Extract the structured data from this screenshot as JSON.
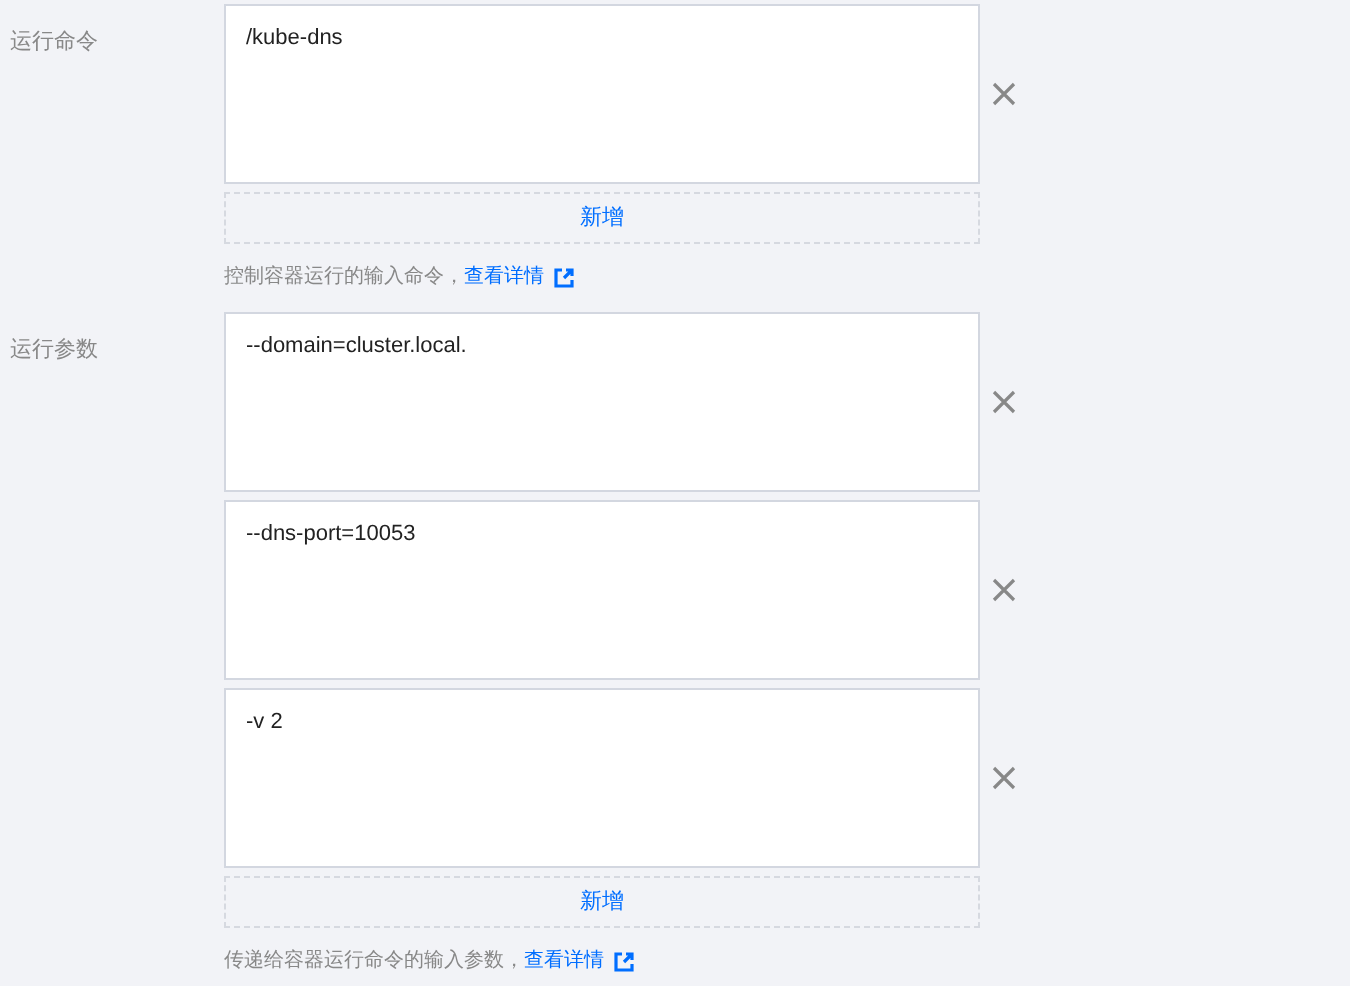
{
  "sections": [
    {
      "label": "运行命令",
      "values": [
        "/kube-dns"
      ],
      "add_button": "新增",
      "help": "控制容器运行的输入命令，",
      "help_link": "查看详情"
    },
    {
      "label": "运行参数",
      "values": [
        "--domain=cluster.local.",
        "--dns-port=10053",
        "-v 2"
      ],
      "add_button": "新增",
      "help": "传递给容器运行命令的输入参数，",
      "help_link": "查看详情"
    }
  ]
}
